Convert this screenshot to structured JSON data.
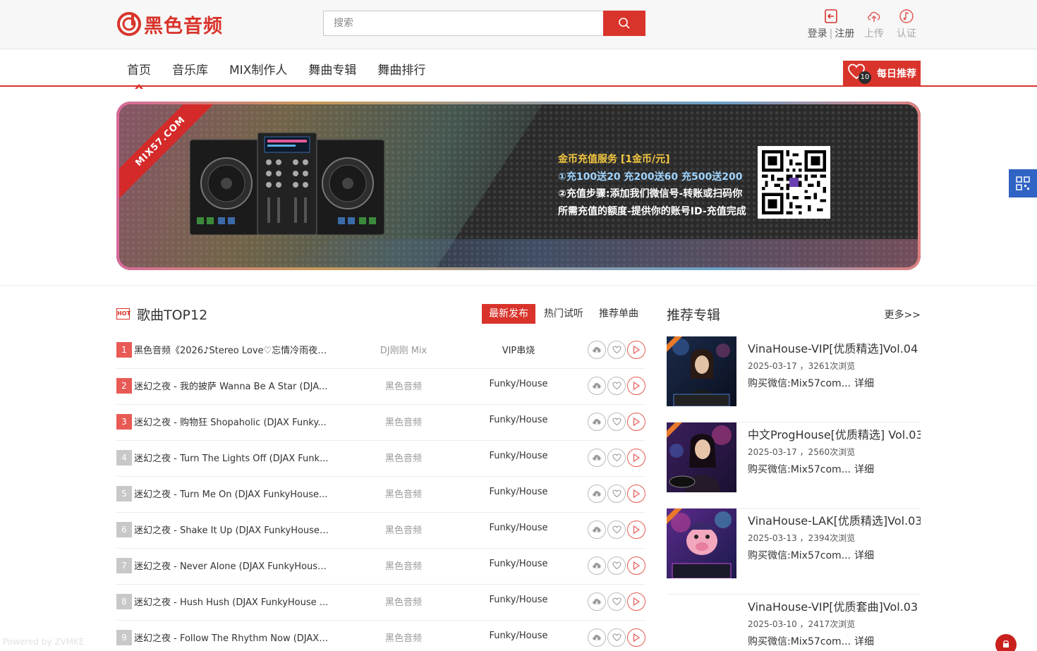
{
  "header": {
    "logo_text": "黑色音频",
    "search_placeholder": "搜索",
    "login_label": "登录",
    "register_label": "注册",
    "login_sep": "|",
    "upload_label": "上传",
    "verify_label": "认证",
    "brand_color": "#d9342b"
  },
  "nav": {
    "items": [
      "首页",
      "音乐库",
      "MIX制作人",
      "舞曲专辑",
      "舞曲排行"
    ],
    "active_index": 0,
    "daily_label": "每日推荐",
    "daily_badge": "10"
  },
  "banner": {
    "ribbon_text": "MIX57.COM",
    "lines": [
      "金币充值服务 [1金币/元]",
      "①充100送20 充200送60 充500送200",
      "②充值步骤:添加我们微信号-转账或扫码你",
      "所需充值的额度-提供你的账号ID-充值完成"
    ]
  },
  "top12": {
    "title": "歌曲TOP12",
    "hot_badge": "HOT",
    "tabs": [
      "最新发布",
      "热门试听",
      "推荐单曲"
    ],
    "active_tab": 0,
    "songs": [
      {
        "rank": "1",
        "title": "黑色音频《2026♪Stereo Love♡忘情冷雨夜♪...",
        "artist": "DJ刚刚 Mix",
        "genre": "VIP串烧"
      },
      {
        "rank": "2",
        "title": "迷幻之夜 - 我的披萨 Wanna Be A Star (DJA...",
        "artist": "黑色音频",
        "genre": "Funky/House"
      },
      {
        "rank": "3",
        "title": "迷幻之夜 - 购物狂 Shopaholic (DJAX Funky...",
        "artist": "黑色音频",
        "genre": "Funky/House"
      },
      {
        "rank": "4",
        "title": "迷幻之夜 - Turn The Lights Off (DJAX Funk...",
        "artist": "黑色音频",
        "genre": "Funky/House"
      },
      {
        "rank": "5",
        "title": "迷幻之夜 - Turn Me On (DJAX FunkyHouse...",
        "artist": "黑色音频",
        "genre": "Funky/House"
      },
      {
        "rank": "6",
        "title": "迷幻之夜 - Shake It Up (DJAX FunkyHouse ...",
        "artist": "黑色音频",
        "genre": "Funky/House"
      },
      {
        "rank": "7",
        "title": "迷幻之夜 - Never Alone (DJAX FunkyHouse...",
        "artist": "黑色音频",
        "genre": "Funky/House"
      },
      {
        "rank": "8",
        "title": "迷幻之夜 - Hush Hush (DJAX FunkyHouse ...",
        "artist": "黑色音频",
        "genre": "Funky/House"
      },
      {
        "rank": "9",
        "title": "迷幻之夜 - Follow The Rhythm Now (DJAX ...",
        "artist": "黑色音频",
        "genre": "Funky/House"
      }
    ]
  },
  "albums": {
    "title": "推荐专辑",
    "more_label": "更多>>",
    "items": [
      {
        "name": "VinaHouse-VIP[优质精选]Vol.04",
        "meta": "2025-03-17 ，3261次浏览",
        "buy": "购买微信:Mix57com...",
        "detail": "详细"
      },
      {
        "name": "中文ProgHouse[优质精选] Vol.03",
        "meta": "2025-03-17 ，2560次浏览",
        "buy": "购买微信:Mix57com...",
        "detail": "详细"
      },
      {
        "name": "VinaHouse-LAK[优质精选]Vol.03",
        "meta": "2025-03-13 ，2394次浏览",
        "buy": "购买微信:Mix57com...",
        "detail": "详细"
      },
      {
        "name": "VinaHouse-VIP[优质套曲]Vol.03",
        "meta": "2025-03-10 ，2417次浏览",
        "buy": "购买微信:Mix57com...",
        "detail": "详细"
      }
    ]
  },
  "footer": {
    "watermark": "Powered by ZVMKE"
  }
}
